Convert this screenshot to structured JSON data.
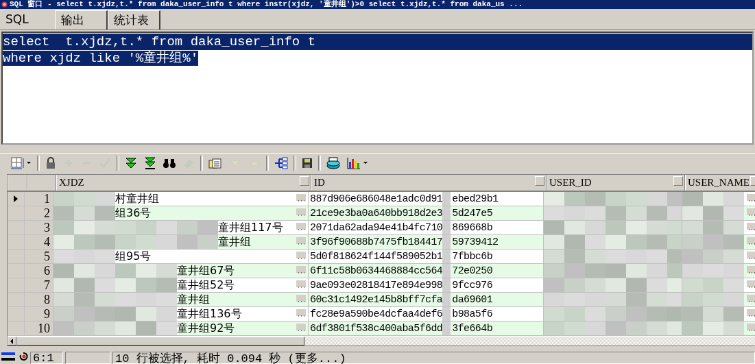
{
  "window": {
    "title": "SQL 窗口 - select t.xjdz,t.* from daka_user_info t where instr(xjdz, '童井组')>0 select t.xjdz,t.* from daka_us ..."
  },
  "tabs": [
    {
      "label": "SQL",
      "selected": true
    },
    {
      "label": "输出",
      "selected": false
    },
    {
      "label": "统计表",
      "selected": false
    }
  ],
  "editor": {
    "lines": [
      {
        "text": "select  t.xjdz,t.* from daka_user_info t",
        "selected": true
      },
      {
        "text": "where xjdz like '%童井组%'",
        "selected": true
      }
    ]
  },
  "toolbar": [
    {
      "kind": "grid",
      "disabled": false
    },
    {
      "kind": "lock",
      "disabled": false
    },
    {
      "kind": "plus",
      "disabled": true
    },
    {
      "kind": "minus",
      "disabled": true
    },
    {
      "kind": "check",
      "disabled": true
    },
    {
      "kind": "next",
      "disabled": false
    },
    {
      "kind": "last",
      "disabled": false
    },
    {
      "kind": "find",
      "disabled": false
    },
    {
      "kind": "eraser",
      "disabled": true
    },
    {
      "kind": "pages",
      "disabled": false
    },
    {
      "kind": "down",
      "disabled": true
    },
    {
      "kind": "up",
      "disabled": true
    },
    {
      "kind": "tree",
      "disabled": false
    },
    {
      "kind": "save",
      "disabled": false
    },
    {
      "kind": "db",
      "disabled": false
    },
    {
      "kind": "chart",
      "disabled": false
    }
  ],
  "table": {
    "columns": [
      "XJDZ",
      "ID",
      "USER_ID",
      "USER_NAME"
    ],
    "rows": [
      {
        "number": "1",
        "selected": true,
        "xjdz": "村童井组",
        "id_start": "887d906e686048e1adc0d91",
        "id_end": "ebed29b1"
      },
      {
        "number": "2",
        "selected": false,
        "xjdz": "组36号",
        "id_start": "21ce9e3ba0a640bb918d2e3",
        "id_end": "5d247e5"
      },
      {
        "number": "3",
        "selected": false,
        "xjdz": "童井组117号",
        "id_start": "2071da62ada94e41b4fc710",
        "id_end": "869668b"
      },
      {
        "number": "4",
        "selected": false,
        "xjdz": "童井组",
        "id_start": "3f96f90688b7475fb184417",
        "id_end": "59739412"
      },
      {
        "number": "5",
        "selected": false,
        "xjdz": "组95号",
        "id_start": "5d0f818624f144f589052b1",
        "id_end": "7fbbc6b"
      },
      {
        "number": "6",
        "selected": false,
        "xjdz": "童井组67号",
        "id_start": "6f11c58b0634468884cc564",
        "id_end": "72e0250"
      },
      {
        "number": "7",
        "selected": false,
        "xjdz": "童井组52号",
        "id_start": "9ae093e02818417e894e998",
        "id_end": "9fcc976"
      },
      {
        "number": "8",
        "selected": false,
        "xjdz": "童井组",
        "id_start": "60c31c1492e145b8bff7cfa",
        "id_end": "da69601"
      },
      {
        "number": "9",
        "selected": false,
        "xjdz": "童井组136号",
        "id_start": "fc28e9a590be4dcfaa4def6",
        "id_end": "b98a5f6"
      },
      {
        "number": "10",
        "selected": false,
        "xjdz": "童井组92号",
        "id_start": "6df3801f538c400aba5f6dd",
        "id_end": "3fe664b"
      }
    ]
  },
  "status_bar": {
    "position": "6:1",
    "message": "10 行被选择, 耗时 0.094 秒 (更多...)"
  }
}
